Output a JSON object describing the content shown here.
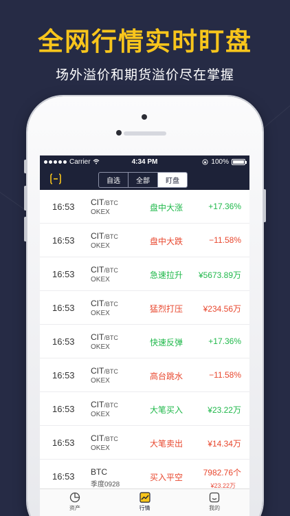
{
  "promo": {
    "headline": "全网行情实时盯盘",
    "subline": "场外溢价和期货溢价尽在掌握"
  },
  "statusbar": {
    "carrier": "Carrier",
    "time": "4:34 PM",
    "battery": "100%"
  },
  "segments": [
    "自选",
    "全部",
    "盯盘"
  ],
  "selected_segment": "盯盘",
  "rows": [
    {
      "time": "16:53",
      "coin": "CIT",
      "pair": "/BTC",
      "exchange": "OKEX",
      "signal": "盘中大涨",
      "signal_color": "green",
      "value": "+17.36%",
      "value_color": "green"
    },
    {
      "time": "16:53",
      "coin": "CIT",
      "pair": "/BTC",
      "exchange": "OKEX",
      "signal": "盘中大跌",
      "signal_color": "red",
      "value": "−11.58%",
      "value_color": "red"
    },
    {
      "time": "16:53",
      "coin": "CIT",
      "pair": "/BTC",
      "exchange": "OKEX",
      "signal": "急速拉升",
      "signal_color": "green",
      "value": "¥5673.89万",
      "value_color": "green"
    },
    {
      "time": "16:53",
      "coin": "CIT",
      "pair": "/BTC",
      "exchange": "OKEX",
      "signal": "猛烈打压",
      "signal_color": "red",
      "value": "¥234.56万",
      "value_color": "red"
    },
    {
      "time": "16:53",
      "coin": "CIT",
      "pair": "/BTC",
      "exchange": "OKEX",
      "signal": "快速反弹",
      "signal_color": "green",
      "value": "+17.36%",
      "value_color": "green"
    },
    {
      "time": "16:53",
      "coin": "CIT",
      "pair": "/BTC",
      "exchange": "OKEX",
      "signal": "高台跳水",
      "signal_color": "red",
      "value": "−11.58%",
      "value_color": "red"
    },
    {
      "time": "16:53",
      "coin": "CIT",
      "pair": "/BTC",
      "exchange": "OKEX",
      "signal": "大笔买入",
      "signal_color": "green",
      "value": "¥23.22万",
      "value_color": "green"
    },
    {
      "time": "16:53",
      "coin": "CIT",
      "pair": "/BTC",
      "exchange": "OKEX",
      "signal": "大笔卖出",
      "signal_color": "red",
      "value": "¥14.34万",
      "value_color": "red"
    },
    {
      "time": "16:53",
      "coin": "BTC",
      "pair": "",
      "exchange": "季度0928",
      "signal": "买入平空",
      "signal_color": "red",
      "value": "7982.76个",
      "value_color": "red",
      "value2": "¥23.22万"
    }
  ],
  "tabs": [
    {
      "label": "资产",
      "icon": "pie-chart-icon",
      "active": false
    },
    {
      "label": "行情",
      "icon": "trend-chart-icon",
      "active": true
    },
    {
      "label": "我的",
      "icon": "profile-face-icon",
      "active": false
    }
  ],
  "colors": {
    "background": "#262b45",
    "headline": "#f8c51c",
    "navbar": "#1d2238",
    "up": "#1fb84a",
    "down": "#e8472e"
  }
}
